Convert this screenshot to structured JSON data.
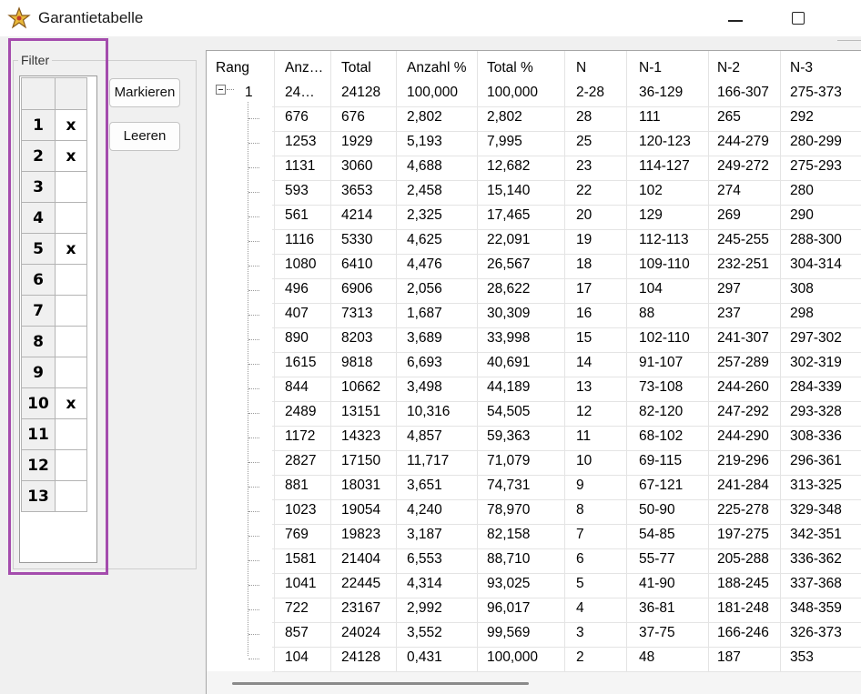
{
  "window": {
    "title": "Garantietabelle"
  },
  "filter": {
    "legend": "Filter",
    "rows": [
      {
        "num": "1",
        "mark": "x"
      },
      {
        "num": "2",
        "mark": "x"
      },
      {
        "num": "3",
        "mark": ""
      },
      {
        "num": "4",
        "mark": ""
      },
      {
        "num": "5",
        "mark": "x"
      },
      {
        "num": "6",
        "mark": ""
      },
      {
        "num": "7",
        "mark": ""
      },
      {
        "num": "8",
        "mark": ""
      },
      {
        "num": "9",
        "mark": ""
      },
      {
        "num": "10",
        "mark": "x"
      },
      {
        "num": "11",
        "mark": ""
      },
      {
        "num": "12",
        "mark": ""
      },
      {
        "num": "13",
        "mark": ""
      }
    ]
  },
  "buttons": {
    "markieren": "Markieren",
    "leeren": "Leeren"
  },
  "table": {
    "headers": [
      "Rang",
      "Anz…",
      "Total",
      "Anzahl %",
      "Total %",
      "N",
      "N-1",
      "N-2",
      "N-3"
    ],
    "parent": {
      "rang": "1",
      "anzahl": "24…",
      "total": "24128",
      "anzahl_pct": "100,000",
      "total_pct": "100,000",
      "n": "2-28",
      "n1": "36-129",
      "n2": "166-307",
      "n3": "275-373"
    },
    "rows": [
      [
        "676",
        "676",
        "2,802",
        "2,802",
        "28",
        "111",
        "265",
        "292"
      ],
      [
        "1253",
        "1929",
        "5,193",
        "7,995",
        "25",
        "120-123",
        "244-279",
        "280-299"
      ],
      [
        "1131",
        "3060",
        "4,688",
        "12,682",
        "23",
        "114-127",
        "249-272",
        "275-293"
      ],
      [
        "593",
        "3653",
        "2,458",
        "15,140",
        "22",
        "102",
        "274",
        "280"
      ],
      [
        "561",
        "4214",
        "2,325",
        "17,465",
        "20",
        "129",
        "269",
        "290"
      ],
      [
        "1116",
        "5330",
        "4,625",
        "22,091",
        "19",
        "112-113",
        "245-255",
        "288-300"
      ],
      [
        "1080",
        "6410",
        "4,476",
        "26,567",
        "18",
        "109-110",
        "232-251",
        "304-314"
      ],
      [
        "496",
        "6906",
        "2,056",
        "28,622",
        "17",
        "104",
        "297",
        "308"
      ],
      [
        "407",
        "7313",
        "1,687",
        "30,309",
        "16",
        "88",
        "237",
        "298"
      ],
      [
        "890",
        "8203",
        "3,689",
        "33,998",
        "15",
        "102-110",
        "241-307",
        "297-302"
      ],
      [
        "1615",
        "9818",
        "6,693",
        "40,691",
        "14",
        "91-107",
        "257-289",
        "302-319"
      ],
      [
        "844",
        "10662",
        "3,498",
        "44,189",
        "13",
        "73-108",
        "244-260",
        "284-339"
      ],
      [
        "2489",
        "13151",
        "10,316",
        "54,505",
        "12",
        "82-120",
        "247-292",
        "293-328"
      ],
      [
        "1172",
        "14323",
        "4,857",
        "59,363",
        "11",
        "68-102",
        "244-290",
        "308-336"
      ],
      [
        "2827",
        "17150",
        "11,717",
        "71,079",
        "10",
        "69-115",
        "219-296",
        "296-361"
      ],
      [
        "881",
        "18031",
        "3,651",
        "74,731",
        "9",
        "67-121",
        "241-284",
        "313-325"
      ],
      [
        "1023",
        "19054",
        "4,240",
        "78,970",
        "8",
        "50-90",
        "225-278",
        "329-348"
      ],
      [
        "769",
        "19823",
        "3,187",
        "82,158",
        "7",
        "54-85",
        "197-275",
        "342-351"
      ],
      [
        "1581",
        "21404",
        "6,553",
        "88,710",
        "6",
        "55-77",
        "205-288",
        "336-362"
      ],
      [
        "1041",
        "22445",
        "4,314",
        "93,025",
        "5",
        "41-90",
        "188-245",
        "337-368"
      ],
      [
        "722",
        "23167",
        "2,992",
        "96,017",
        "4",
        "36-81",
        "181-248",
        "348-359"
      ],
      [
        "857",
        "24024",
        "3,552",
        "99,569",
        "3",
        "37-75",
        "166-246",
        "326-373"
      ],
      [
        "104",
        "24128",
        "0,431",
        "100,000",
        "2",
        "48",
        "187",
        "353"
      ]
    ]
  },
  "colors": {
    "highlight": "#a44cad",
    "grid_line": "#e4e4e4"
  }
}
